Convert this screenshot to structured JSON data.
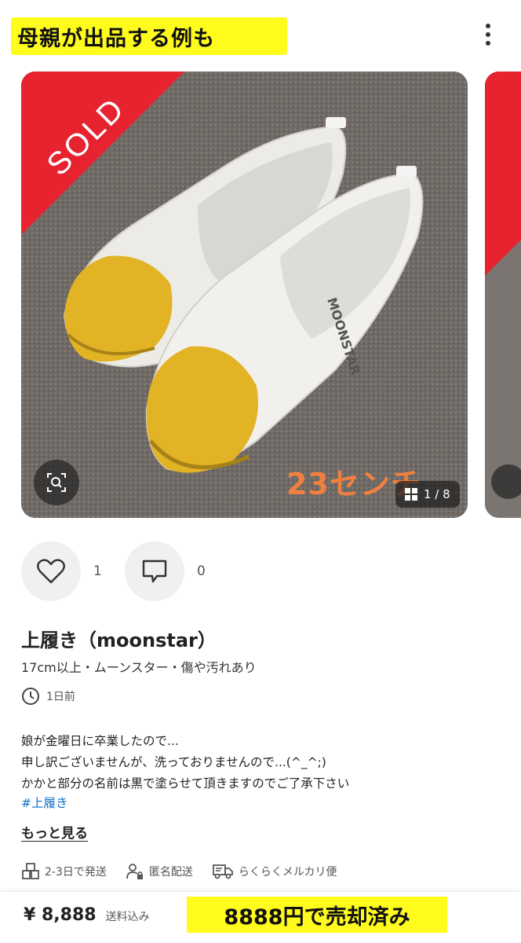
{
  "annotation_top": "母親が出品する例も",
  "listing": {
    "sold_label": "SOLD",
    "size_note": "23センチ",
    "page_indicator": "1 / 8",
    "likes_count": "1",
    "comments_count": "0",
    "title": "上履き（moonstar）",
    "subtitle": "17cm以上・ムーンスター・傷や汚れあり",
    "posted_time": "1日前",
    "description_lines": [
      "娘が金曜日に卒業したので...",
      "申し訳ございませんが、洗っておりませんので...(^_^;)",
      "かかと部分の名前は黒で塗らせて頂きますのでご了承下さい"
    ],
    "hashtag": "#上履き",
    "more_link": "もっと見る",
    "shipping": [
      {
        "icon": "box-icon",
        "label": "2-3日で発送"
      },
      {
        "icon": "anonymous-user-icon",
        "label": "匿名配送"
      },
      {
        "icon": "truck-icon",
        "label": "らくらくメルカリ便"
      }
    ],
    "price": "¥ 8,888",
    "price_note": "送料込み"
  },
  "annotation_bottom": "8888円で売却済み",
  "colors": {
    "sold_ribbon": "#e6232f",
    "annotation_bg": "#fffb1c",
    "shoe_toe": "#e3b326",
    "hashtag": "#0d72c9",
    "size_note": "#f08040"
  }
}
